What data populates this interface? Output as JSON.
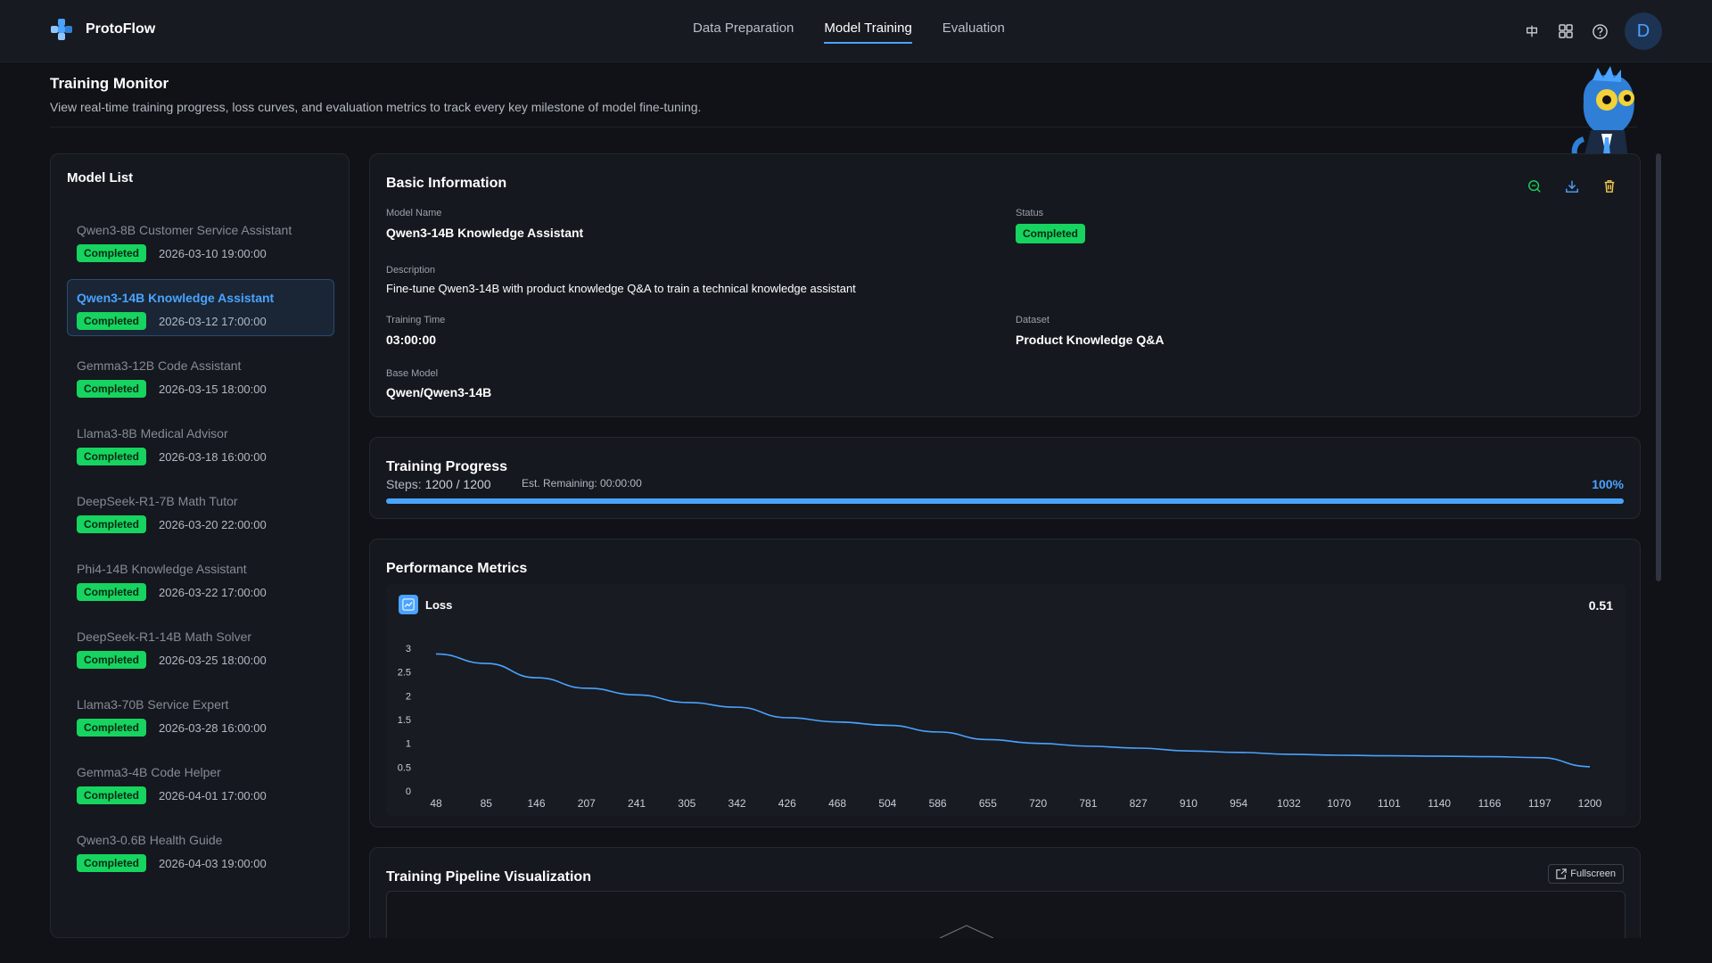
{
  "app": {
    "name": "ProtoFlow",
    "accent": "#4aa3ff",
    "success": "#16d45f"
  },
  "nav": {
    "tabs": [
      {
        "label": "Data Preparation",
        "active": false
      },
      {
        "label": "Model Training",
        "active": true
      },
      {
        "label": "Evaluation",
        "active": false
      }
    ],
    "icons": [
      "language-icon",
      "apps-grid-icon",
      "help-icon"
    ],
    "avatar_letter": "D"
  },
  "page": {
    "title": "Training Monitor",
    "subtitle": "View real-time training progress, loss curves, and evaluation metrics to track every key milestone of model fine-tuning."
  },
  "model_list": {
    "title": "Model List",
    "items": [
      {
        "name": "Qwen3-8B Customer Service Assistant",
        "status": "Completed",
        "date": "2026-03-10 19:00:00",
        "selected": false
      },
      {
        "name": "Qwen3-14B Knowledge Assistant",
        "status": "Completed",
        "date": "2026-03-12 17:00:00",
        "selected": true
      },
      {
        "name": "Gemma3-12B Code Assistant",
        "status": "Completed",
        "date": "2026-03-15 18:00:00",
        "selected": false
      },
      {
        "name": "Llama3-8B Medical Advisor",
        "status": "Completed",
        "date": "2026-03-18 16:00:00",
        "selected": false
      },
      {
        "name": "DeepSeek-R1-7B Math Tutor",
        "status": "Completed",
        "date": "2026-03-20 22:00:00",
        "selected": false
      },
      {
        "name": "Phi4-14B Knowledge Assistant",
        "status": "Completed",
        "date": "2026-03-22 17:00:00",
        "selected": false
      },
      {
        "name": "DeepSeek-R1-14B Math Solver",
        "status": "Completed",
        "date": "2026-03-25 18:00:00",
        "selected": false
      },
      {
        "name": "Llama3-70B Service Expert",
        "status": "Completed",
        "date": "2026-03-28 16:00:00",
        "selected": false
      },
      {
        "name": "Gemma3-4B Code Helper",
        "status": "Completed",
        "date": "2026-04-01 17:00:00",
        "selected": false
      },
      {
        "name": "Qwen3-0.6B Health Guide",
        "status": "Completed",
        "date": "2026-04-03 19:00:00",
        "selected": false
      }
    ]
  },
  "basic_info": {
    "title": "Basic Information",
    "actions": [
      "chat-test-icon",
      "download-icon",
      "delete-icon"
    ],
    "model_name_label": "Model Name",
    "model_name": "Qwen3-14B Knowledge Assistant",
    "status_label": "Status",
    "status": "Completed",
    "description_label": "Description",
    "description": "Fine-tune Qwen3-14B with product knowledge Q&A to train a technical knowledge assistant",
    "training_time_label": "Training Time",
    "training_time": "03:00:00",
    "dataset_label": "Dataset",
    "dataset": "Product Knowledge Q&A",
    "base_model_label": "Base Model",
    "base_model": "Qwen/Qwen3-14B"
  },
  "progress": {
    "title": "Training Progress",
    "steps_label": "Steps:",
    "steps_value": "1200 / 1200",
    "eta_label": "Est. Remaining:",
    "eta_value": "00:00:00",
    "percent_label": "100%",
    "fraction": 1.0
  },
  "metrics": {
    "title": "Performance Metrics",
    "metric_label": "Loss",
    "metric_value": "0.51"
  },
  "chart_data": {
    "type": "line",
    "title": "Loss",
    "x": [
      "48",
      "85",
      "146",
      "207",
      "241",
      "305",
      "342",
      "426",
      "468",
      "504",
      "586",
      "655",
      "720",
      "781",
      "827",
      "910",
      "954",
      "1032",
      "1070",
      "1101",
      "1140",
      "1166",
      "1197",
      "1200"
    ],
    "series": [
      {
        "name": "Loss",
        "values": [
          2.88,
          2.68,
          2.38,
          2.16,
          2.02,
          1.86,
          1.76,
          1.54,
          1.45,
          1.38,
          1.24,
          1.08,
          1.0,
          0.94,
          0.9,
          0.84,
          0.81,
          0.77,
          0.75,
          0.74,
          0.73,
          0.72,
          0.7,
          0.51
        ]
      }
    ],
    "y_ticks": [
      "0",
      "0.5",
      "1",
      "1.5",
      "2",
      "2.5",
      "3"
    ],
    "ylim": [
      0,
      3
    ],
    "grid": false,
    "line_color": "#4aa3ff"
  },
  "pipeline": {
    "title": "Training Pipeline Visualization",
    "fullscreen_label": "Fullscreen"
  }
}
